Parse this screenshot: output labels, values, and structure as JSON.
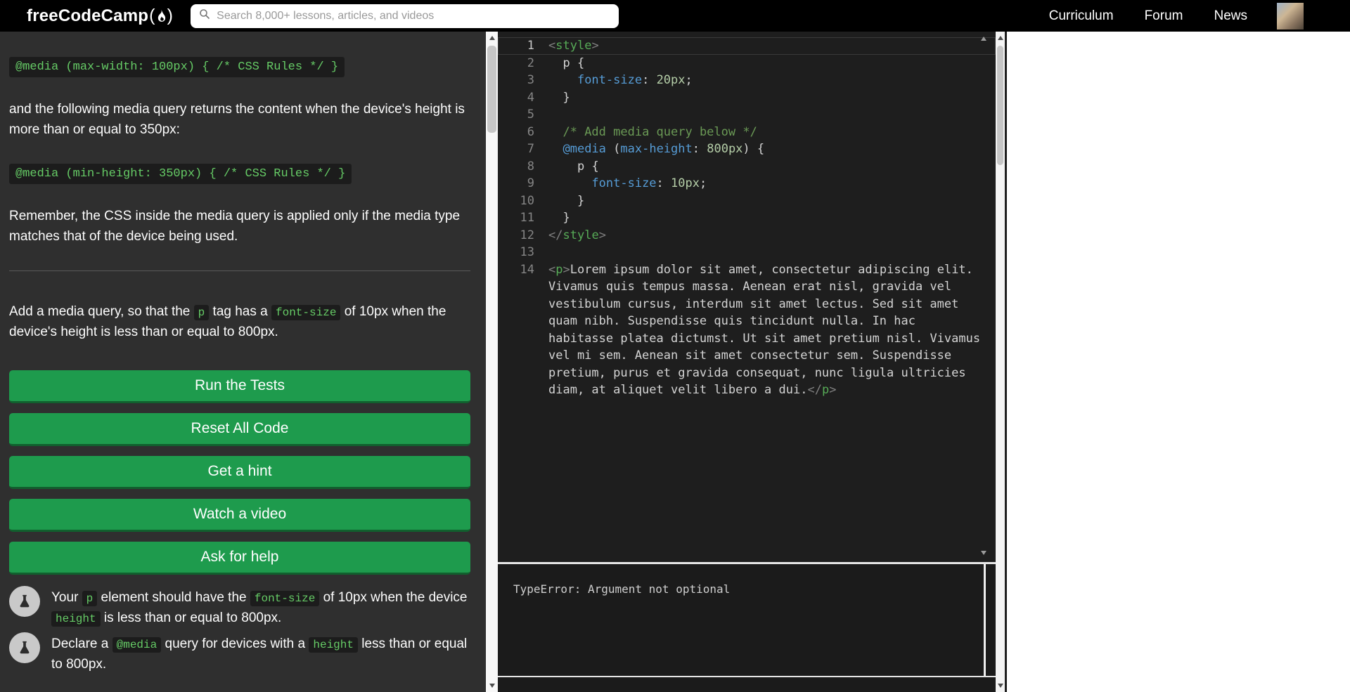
{
  "header": {
    "logo": "freeCodeCamp",
    "search_placeholder": "Search 8,000+ lessons, articles, and videos",
    "nav": [
      "Curriculum",
      "Forum",
      "News"
    ]
  },
  "instructions": {
    "blocks": [
      {
        "type": "codeblock",
        "text": "@media (max-width: 100px) { /* CSS Rules */ }"
      },
      {
        "type": "para",
        "segments": [
          {
            "text": "and the following media query returns the content when the device's height is more than or equal to 350px:"
          }
        ]
      },
      {
        "type": "codeblock",
        "text": "@media (min-height: 350px) { /* CSS Rules */ }"
      },
      {
        "type": "para",
        "segments": [
          {
            "text": "Remember, the CSS inside the media query is applied only if the media type matches that of the device being used."
          }
        ]
      },
      {
        "type": "divider"
      },
      {
        "type": "para",
        "challenge": true,
        "segments": [
          {
            "text": "Add a media query, so that the "
          },
          {
            "text": "p",
            "code": true
          },
          {
            "text": " tag has a "
          },
          {
            "text": "font-size",
            "code": true
          },
          {
            "text": " of 10px when the device's height is less than or equal to 800px."
          }
        ]
      }
    ]
  },
  "buttons": [
    "Run the Tests",
    "Reset All Code",
    "Get a hint",
    "Watch a video",
    "Ask for help"
  ],
  "tests": [
    {
      "segments": [
        {
          "text": "Your "
        },
        {
          "text": "p",
          "code": true
        },
        {
          "text": " element should have the "
        },
        {
          "text": "font-size",
          "code": true
        },
        {
          "text": " of 10px when the device "
        },
        {
          "text": "height",
          "code": true
        },
        {
          "text": " is less than or equal to 800px."
        }
      ]
    },
    {
      "segments": [
        {
          "text": "Declare a "
        },
        {
          "text": "@media",
          "code": true
        },
        {
          "text": " query for devices with a "
        },
        {
          "text": "height",
          "code": true
        },
        {
          "text": " less than or equal to 800px."
        }
      ]
    }
  ],
  "editor": {
    "lines": [
      {
        "n": "1",
        "tokens": [
          {
            "c": "pun",
            "t": "<"
          },
          {
            "c": "tag",
            "t": "style"
          },
          {
            "c": "pun",
            "t": ">"
          }
        ]
      },
      {
        "n": "2",
        "tokens": [
          {
            "c": "pln",
            "t": "  "
          },
          {
            "c": "sel",
            "t": "p"
          },
          {
            "c": "pln",
            "t": " {"
          }
        ]
      },
      {
        "n": "3",
        "tokens": [
          {
            "c": "pln",
            "t": "    "
          },
          {
            "c": "prop",
            "t": "font-size"
          },
          {
            "c": "pln",
            "t": ": "
          },
          {
            "c": "num",
            "t": "20px"
          },
          {
            "c": "pln",
            "t": ";"
          }
        ]
      },
      {
        "n": "4",
        "tokens": [
          {
            "c": "pln",
            "t": "  }"
          }
        ]
      },
      {
        "n": "5",
        "tokens": []
      },
      {
        "n": "6",
        "tokens": [
          {
            "c": "pln",
            "t": "  "
          },
          {
            "c": "com",
            "t": "/* Add media query below */"
          }
        ]
      },
      {
        "n": "7",
        "tokens": [
          {
            "c": "pln",
            "t": "  "
          },
          {
            "c": "at",
            "t": "@media"
          },
          {
            "c": "pln",
            "t": " ("
          },
          {
            "c": "prop",
            "t": "max-height"
          },
          {
            "c": "pln",
            "t": ": "
          },
          {
            "c": "num",
            "t": "800px"
          },
          {
            "c": "pln",
            "t": ") {"
          }
        ]
      },
      {
        "n": "8",
        "tokens": [
          {
            "c": "pln",
            "t": "    "
          },
          {
            "c": "sel",
            "t": "p"
          },
          {
            "c": "pln",
            "t": " {"
          }
        ]
      },
      {
        "n": "9",
        "tokens": [
          {
            "c": "pln",
            "t": "      "
          },
          {
            "c": "prop",
            "t": "font-size"
          },
          {
            "c": "pln",
            "t": ": "
          },
          {
            "c": "num",
            "t": "10px"
          },
          {
            "c": "pln",
            "t": ";"
          }
        ]
      },
      {
        "n": "10",
        "tokens": [
          {
            "c": "pln",
            "t": "    }"
          }
        ]
      },
      {
        "n": "11",
        "tokens": [
          {
            "c": "pln",
            "t": "  }"
          }
        ]
      },
      {
        "n": "12",
        "tokens": [
          {
            "c": "pun",
            "t": "<"
          },
          {
            "c": "pun",
            "t": "/"
          },
          {
            "c": "tag",
            "t": "style"
          },
          {
            "c": "pun",
            "t": ">"
          }
        ]
      },
      {
        "n": "13",
        "tokens": []
      },
      {
        "n": "14",
        "wrap": true,
        "tokens": [
          {
            "c": "pun",
            "t": "<"
          },
          {
            "c": "tag",
            "t": "p"
          },
          {
            "c": "pun",
            "t": ">"
          },
          {
            "c": "txt",
            "t": "Lorem ipsum dolor sit amet, consectetur adipiscing elit. Vivamus quis tempus massa. Aenean erat nisl, gravida vel vestibulum cursus, interdum sit amet lectus. Sed sit amet quam nibh. Suspendisse quis tincidunt nulla. In hac habitasse platea dictumst. Ut sit amet pretium nisl. Vivamus vel mi sem. Aenean sit amet consectetur sem. Suspendisse pretium, purus et gravida consequat, nunc ligula ultricies diam, at aliquet velit libero a dui."
          },
          {
            "c": "pun",
            "t": "<"
          },
          {
            "c": "pun",
            "t": "/"
          },
          {
            "c": "tag",
            "t": "p"
          },
          {
            "c": "pun",
            "t": ">"
          }
        ]
      }
    ]
  },
  "console": {
    "output": "TypeError: Argument not optional"
  },
  "colors": {
    "button_green": "#1e9b4d",
    "code_green": "#66cc66",
    "header_bg": "#000000",
    "editor_bg": "#1e1e1e"
  }
}
